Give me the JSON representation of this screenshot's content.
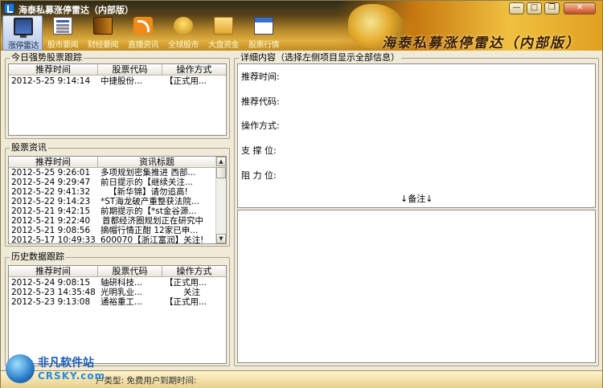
{
  "window": {
    "title": "海泰私募涨停雷达（内部版）",
    "banner_text": "海泰私募涨停雷达（内部版）",
    "buttons": {
      "minimize": "—",
      "maximize": "□",
      "restore": "❐",
      "close": "✕"
    }
  },
  "toolbar": {
    "items": [
      {
        "label": "涨停雷达",
        "icon": "monitor-icon",
        "active": true
      },
      {
        "label": "股市要闻",
        "icon": "newspaper-icon",
        "active": false
      },
      {
        "label": "财经要闻",
        "icon": "book-icon",
        "active": false
      },
      {
        "label": "直播资讯",
        "icon": "rss-icon",
        "active": false
      },
      {
        "label": "全球股市",
        "icon": "coins-icon",
        "active": false
      },
      {
        "label": "大盘资金",
        "icon": "folder-icon",
        "active": false
      },
      {
        "label": "股票行情",
        "icon": "calendar-icon",
        "active": false
      }
    ]
  },
  "today": {
    "title": "今日强势股票跟踪",
    "columns": [
      "推荐时间",
      "股票代码",
      "操作方式"
    ],
    "rows": [
      [
        "2012-5-25 9:14:14",
        "中捷股份...",
        "【正式用..."
      ]
    ]
  },
  "news": {
    "title": "股票资讯",
    "columns": [
      "推荐时间",
      "资讯标题"
    ],
    "rows": [
      [
        "2012-5-25 9:26:01",
        "多项规划密集推进 西部..."
      ],
      [
        "2012-5-24 9:29:47",
        "前日提示的【继续关注..."
      ],
      [
        "2012-5-22 9:41:32",
        "【新华锦】请勿追高!"
      ],
      [
        "2012-5-22 9:14:23",
        "*ST海龙破产重整获法院..."
      ],
      [
        "2012-5-21 9:42:15",
        "前期提示的【*st金谷源..."
      ],
      [
        "2012-5-21 9:22:40",
        "首都经济圈规划正在研究中"
      ],
      [
        "2012-5-21 9:08:56",
        "摘帽行情正酣 12家已申..."
      ],
      [
        "2012-5-17 10:49:33",
        "600070【浙江富润】关注!"
      ]
    ]
  },
  "history": {
    "title": "历史数据跟踪",
    "columns": [
      "推荐时间",
      "股票代码",
      "操作方式"
    ],
    "rows": [
      [
        "2012-5-24 9:08:15",
        "轴研科技...",
        "【正式用..."
      ],
      [
        "2012-5-23 14:35:48",
        "光明乳业...",
        "关注"
      ],
      [
        "2012-5-23 9:13:08",
        "通裕重工...",
        "【正式用..."
      ]
    ]
  },
  "detail": {
    "title": "详细内容（选择左侧项目显示全部信息）",
    "fields": [
      {
        "label": "推荐时间:",
        "value": ""
      },
      {
        "label": "推荐代码:",
        "value": ""
      },
      {
        "label": "操作方式:",
        "value": ""
      },
      {
        "label": "支 撑 位:",
        "value": ""
      },
      {
        "label": "阻 力 位:",
        "value": ""
      }
    ],
    "note_label": "↓备注↓"
  },
  "status": {
    "user_type": "户类型: 免费用户",
    "expire": "到期时间:"
  },
  "watermark": {
    "line1": "非凡软件站",
    "line2": "CRSKY.com"
  },
  "colors": {
    "header_dark": "#2e2a1a",
    "header_gold": "#e0b040",
    "panel_bg": "#f0ead8"
  }
}
